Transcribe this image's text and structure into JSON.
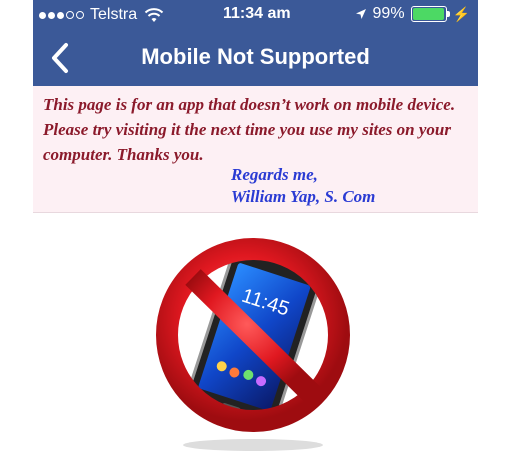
{
  "status_bar": {
    "carrier": "Telstra",
    "time": "11:34 am",
    "battery_percent": "99%",
    "battery_level": 0.99,
    "signal_bars_filled": 3,
    "signal_bars_total": 5
  },
  "nav": {
    "title": "Mobile Not Supported",
    "back_icon": "chevron-left-icon"
  },
  "message": {
    "body": "This page is for an app that doesn’t work on mobile device. Please try visiting it the next time you use my sites on your computer. Thanks you.",
    "regards": "Regards me,",
    "name": "William Yap, S. Com"
  },
  "illustration": {
    "phone_time": "11:45",
    "icon": "no-mobile-phone-icon"
  },
  "colors": {
    "header": "#3b5998",
    "message_text": "#8b1a2b",
    "signature_text": "#2a3bd3",
    "prohibit_red": "#e01820",
    "battery_fill": "#4cd964"
  }
}
